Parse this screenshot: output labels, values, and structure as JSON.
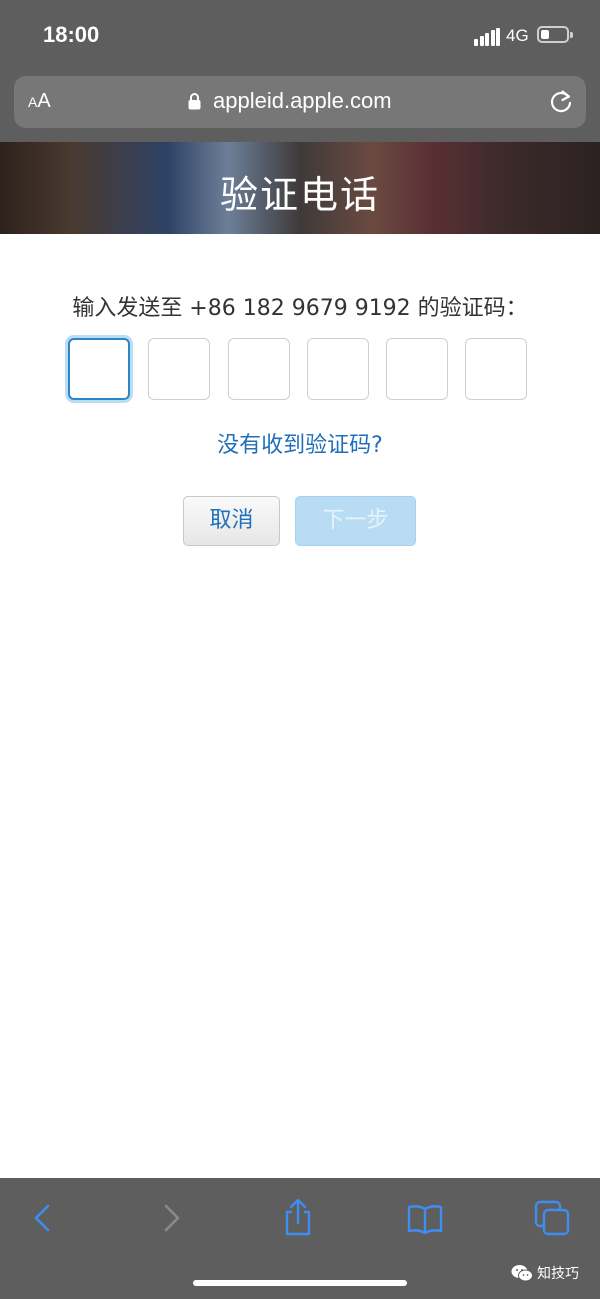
{
  "status_bar": {
    "time": "18:00",
    "network": "4G",
    "battery_fraction": 0.35
  },
  "browser": {
    "text_size_small": "A",
    "text_size_large": "A",
    "url": "appleid.apple.com"
  },
  "header": {
    "title": "验证电话"
  },
  "verification": {
    "prompt": "输入发送至 +86 182 9679 9192 的验证码：",
    "code_digits": [
      "",
      "",
      "",
      "",
      "",
      ""
    ],
    "resend_link": "没有收到验证码?"
  },
  "actions": {
    "cancel_label": "取消",
    "next_label": "下一步"
  },
  "toolbar": {
    "icons": [
      "back-icon",
      "forward-icon",
      "share-icon",
      "bookmarks-icon",
      "tabs-icon"
    ]
  },
  "watermark": {
    "text": "知技巧"
  },
  "colors": {
    "link_blue": "#1f6fb9",
    "focus_blue": "#2b87c9",
    "disabled_button": "#b9dcf5",
    "chrome_gray": "#5e5e5e"
  }
}
